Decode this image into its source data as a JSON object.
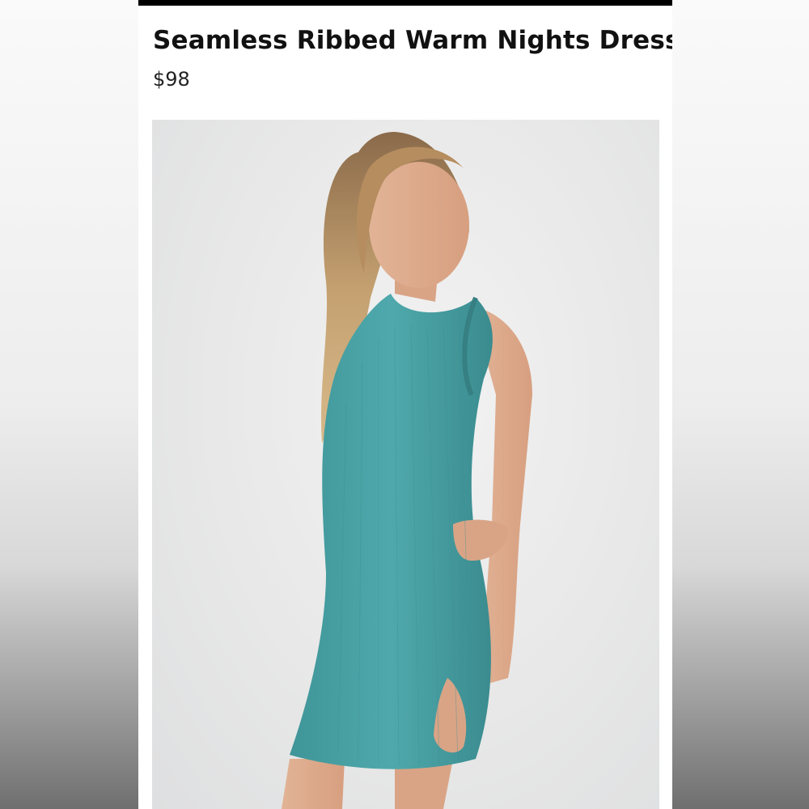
{
  "product": {
    "title": "Seamless Ribbed Warm Nights Dress",
    "price": "$98"
  },
  "image": {
    "subject": "model-wearing-dress-photo",
    "dress_color": "#4aa3a6"
  }
}
